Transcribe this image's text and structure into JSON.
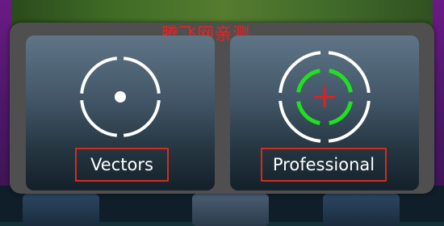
{
  "watermark": "腾飞网亲测",
  "options": [
    {
      "label": "Vectors",
      "icon": "reticle-dot-icon"
    },
    {
      "label": "Professional",
      "icon": "reticle-crosshair-icon"
    }
  ],
  "colors": {
    "ring": "#ffffff",
    "inner_ring": "#20e020",
    "crosshair": "#e02020",
    "highlight_box": "#d52b1e"
  }
}
